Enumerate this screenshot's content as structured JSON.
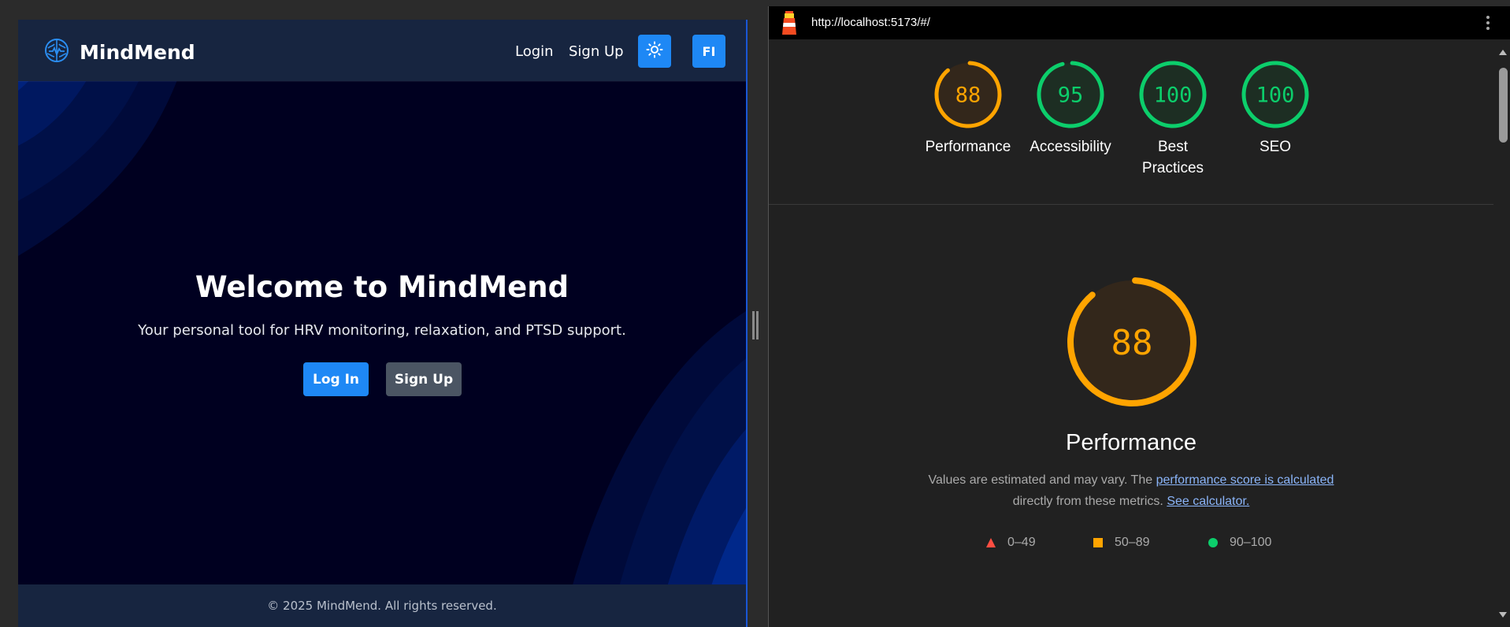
{
  "app": {
    "brand": {
      "name": "MindMend",
      "icon": "brain-icon"
    },
    "nav": {
      "login": "Login",
      "signup": "Sign Up",
      "theme_icon": "sun-icon",
      "lang": "FI"
    },
    "hero": {
      "title": "Welcome to MindMend",
      "subtitle": "Your personal tool for HRV monitoring, relaxation, and PTSD support.",
      "login_button": "Log In",
      "signup_button": "Sign Up"
    },
    "footer": "© 2025 MindMend. All rights reserved.",
    "colors": {
      "background": "#000020",
      "header": "#172540",
      "primary": "#1e88f5",
      "secondary": "#4b5563"
    }
  },
  "lighthouse": {
    "url": "http://localhost:5173/#/",
    "icon": "lighthouse-icon",
    "scores": [
      {
        "label": "Performance",
        "value": 88,
        "color": "#ffa400",
        "fill": "#33271b"
      },
      {
        "label": "Accessibility",
        "value": 95,
        "color": "#0cce6b",
        "fill": "#1d2e23"
      },
      {
        "label": "Best Practices",
        "value": 100,
        "color": "#0cce6b",
        "fill": "#1d2e23"
      },
      {
        "label": "SEO",
        "value": 100,
        "color": "#0cce6b",
        "fill": "#1d2e23"
      }
    ],
    "main": {
      "score": 88,
      "title": "Performance",
      "desc_prefix": "Values are estimated and may vary. The ",
      "desc_link1": "performance score is calculated",
      "desc_middle": " directly from these metrics. ",
      "desc_link2": "See calculator."
    },
    "legend": [
      {
        "shape": "triangle",
        "range": "0–49",
        "color": "#ff4e42"
      },
      {
        "shape": "square",
        "range": "50–89",
        "color": "#ffa400"
      },
      {
        "shape": "circle",
        "range": "90–100",
        "color": "#0cce6b"
      }
    ]
  }
}
